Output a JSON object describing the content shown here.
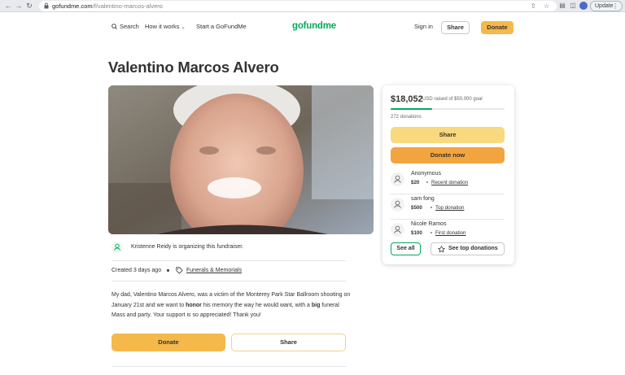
{
  "browser": {
    "url_host": "gofundme.com",
    "url_path": "/f/valentino-marcos-alvero",
    "update_label": "Update"
  },
  "header": {
    "search_label": "Search",
    "how_it_works_label": "How it works",
    "start_label": "Start a GoFundMe",
    "logo_text": "gofundme",
    "sign_in_label": "Sign in",
    "share_label": "Share",
    "donate_label": "Donate"
  },
  "campaign": {
    "title": "Valentino Marcos Alvero",
    "organizer_text": "Kristenne Reidy is organizing this fundraiser.",
    "created_text": "Created 3 days ago",
    "category": "Funerals & Memorials",
    "story_part1": "My dad, Valentino Marcos Alvero, was a victim of the Monterey Park Star Ballroom shooting on January 21st and we want to ",
    "story_bold1": "honor",
    "story_part2": " his memory the way he would want, with a ",
    "story_bold2": "big",
    "story_part3": " funeral Mass and party. Your support is so appreciated! Thank you!",
    "donate_label": "Donate",
    "share_label": "Share"
  },
  "card": {
    "raised_amount": "$18,052",
    "raised_text": "USD raised of $50,000 goal",
    "progress_fraction": 0.361,
    "donations_count_text": "272 donations",
    "share_label": "Share",
    "donate_now_label": "Donate now",
    "donors": [
      {
        "name": "Anonymous",
        "amount": "$20",
        "label": "Recent donation"
      },
      {
        "name": "sam fong",
        "amount": "$500",
        "label": "Top donation"
      },
      {
        "name": "Nicole Ramos",
        "amount": "$100",
        "label": "First donation"
      }
    ],
    "see_all_label": "See all",
    "see_top_label": "See top donations"
  },
  "colors": {
    "brand_green": "#02a95c",
    "donate_yellow": "#f5b84a",
    "donate_orange": "#f2a53f",
    "share_yellow": "#f8d97e"
  }
}
